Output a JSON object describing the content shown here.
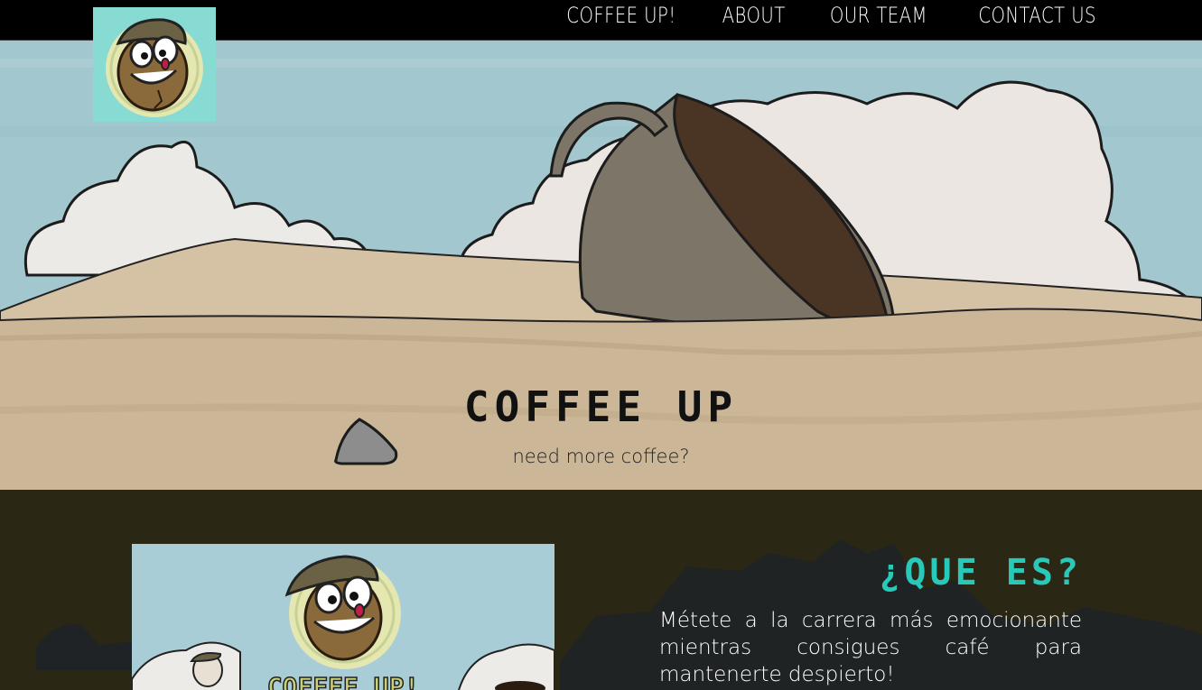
{
  "nav": {
    "links": [
      {
        "label": "COFFEE UP!"
      },
      {
        "label": "ABOUT"
      },
      {
        "label": "OUR TEAM"
      },
      {
        "label": "CONTACT US"
      }
    ]
  },
  "hero": {
    "title": "COFFEE UP",
    "subtitle": "need more coffee?"
  },
  "about": {
    "heading": "¿QUE ES?",
    "text": "Métete a la carrera más emocionante mientras consigues café para mantenerte despierto!",
    "image_text": "COFFEE UP!"
  },
  "colors": {
    "navbar": "#000000",
    "logo_bg": "#87dbd2",
    "sky": "#a5c8cf",
    "sand": "#cbb697",
    "about_bg": "#2b2715",
    "accent": "#29c9b9"
  }
}
